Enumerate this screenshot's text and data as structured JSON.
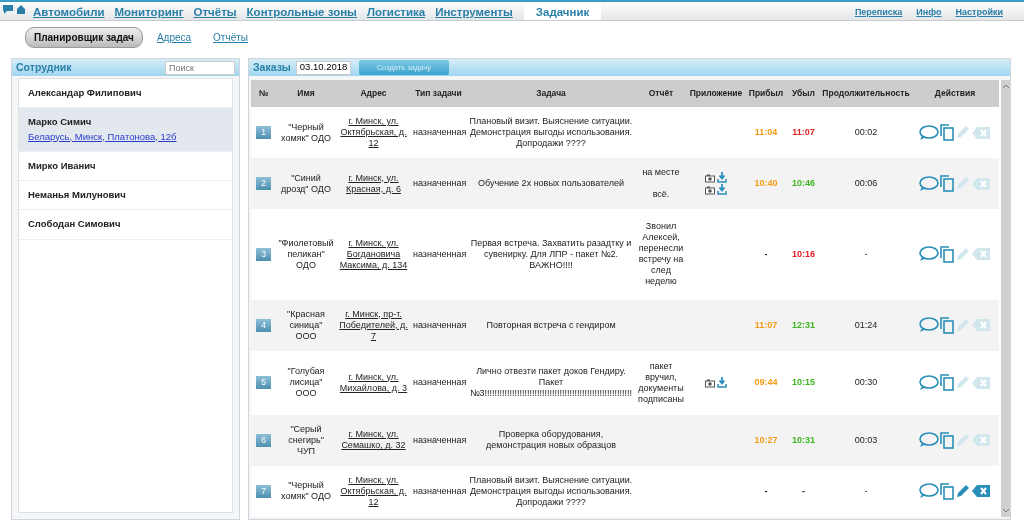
{
  "nav": {
    "items": [
      {
        "label": "Автомобили",
        "selected": false
      },
      {
        "label": "Мониторинг",
        "selected": false
      },
      {
        "label": "Отчёты",
        "selected": false
      },
      {
        "label": "Контрольные зоны",
        "selected": false
      },
      {
        "label": "Логистика",
        "selected": false
      },
      {
        "label": "Инструменты",
        "selected": false
      },
      {
        "label": "Задачник",
        "selected": true
      }
    ],
    "links": [
      "Переписка",
      "Инфо",
      "Настройки"
    ]
  },
  "subnav": [
    {
      "label": "Планировщик задач",
      "selected": true
    },
    {
      "label": "Адреса",
      "selected": false
    },
    {
      "label": "Отчёты",
      "selected": false
    }
  ],
  "employees": {
    "title": "Сотрудник",
    "search": {
      "placeholder": "Поиск"
    },
    "items": [
      {
        "name": "Александар Филипович",
        "selected": false
      },
      {
        "name": "Марко Симич",
        "address": "Беларусь, Минск, Платонова, 12б",
        "selected": true
      },
      {
        "name": "Мирко Иванич",
        "selected": false
      },
      {
        "name": "Неманья Милунович",
        "selected": false
      },
      {
        "name": "Слободан Симович",
        "selected": false
      }
    ]
  },
  "orders": {
    "title": "Заказы",
    "date": "03.10.2018",
    "create_button": "Создать задачу",
    "columns": [
      "№",
      "Имя",
      "Адрес",
      "Тип задачи",
      "Задача",
      "Отчёт",
      "Приложение",
      "Прибыл",
      "Убыл",
      "Продолжительность",
      "Действия"
    ],
    "rows": [
      {
        "number": "1",
        "name": "\"Черный хомяк\" ОДО",
        "address": "г. Минск, ул. Октябрьская, д. 12",
        "type": "назначенная",
        "task": "Плановый визит. Выяснение ситуации. Демонстрация выгоды использования. Допродажи ????",
        "report": [],
        "attachments": [],
        "arrived": {
          "text": "11:04",
          "color": "#f39c12"
        },
        "left": {
          "text": "11:07",
          "color": "#e02424"
        },
        "duration": "00:02",
        "editable": false
      },
      {
        "number": "2",
        "name": "\"Синий дрозд\" ОДО",
        "address": "г. Минск, ул. Красная, д. 6",
        "type": "назначенная",
        "task": "Обучение 2х новых пользователей",
        "report": [
          "на месте",
          "всё."
        ],
        "attachments": [
          {
            "kind": "photo"
          },
          {
            "kind": "photo"
          }
        ],
        "arrived": {
          "text": "10:40",
          "color": "#f39c12"
        },
        "left": {
          "text": "10:46",
          "color": "#3cb521"
        },
        "duration": "00:06",
        "editable": false
      },
      {
        "number": "3",
        "name": "\"Фиолетовый пеликан\" ОДО",
        "address": "г. Минск, ул. Богдановича Максима, д. 134",
        "type": "назначенная",
        "task": "Первая встреча. Захватить разадтку и сувенирку. Для ЛПР - пакет №2. ВАЖНО!!!!",
        "report": [
          "Звонил Алексей, перенесли встречу на след неделю"
        ],
        "attachments": [],
        "arrived": {
          "text": "-"
        },
        "left": {
          "text": "10:16",
          "color": "#e02424"
        },
        "duration": "-",
        "editable": false
      },
      {
        "number": "4",
        "name": "\"Красная синица\" ООО",
        "address": "г. Минск, пр-т. Победителей, д. 7",
        "type": "назначенная",
        "task": "Повторная встреча с гендиром",
        "report": [],
        "attachments": [],
        "arrived": {
          "text": "11:07",
          "color": "#f39c12"
        },
        "left": {
          "text": "12:31",
          "color": "#3cb521"
        },
        "duration": "01:24",
        "editable": false
      },
      {
        "number": "5",
        "name": "\"Голубая лисица\" ООО",
        "address": "г. Минск, ул. Михайлова, д. 3",
        "type": "назначенная",
        "task": "Лично отвезти пакет доков Гендиру. Пакет №3!!!!!!!!!!!!!!!!!!!!!!!!!!!!!!!!!!!!!!!!!!!!!!!!!!!!!!!!!!!",
        "report": [
          "пакет вручил, документы подписаны"
        ],
        "attachments": [
          {
            "kind": "photo"
          }
        ],
        "arrived": {
          "text": "09:44",
          "color": "#f39c12"
        },
        "left": {
          "text": "10:15",
          "color": "#3cb521"
        },
        "duration": "00:30",
        "editable": false
      },
      {
        "number": "6",
        "name": "\"Серый снегирь\" ЧУП",
        "address": "г. Минск, ул. Семашко, д. 32",
        "type": "назначенная",
        "task": "Проверка оборудования, демонстрация новых образцов",
        "report": [],
        "attachments": [],
        "arrived": {
          "text": "10:27",
          "color": "#f39c12"
        },
        "left": {
          "text": "10:31",
          "color": "#3cb521"
        },
        "duration": "00:03",
        "editable": false
      },
      {
        "number": "7",
        "name": "\"Черный хомяк\" ОДО",
        "address": "г. Минск, ул. Октябрьская, д. 12",
        "type": "назначенная",
        "task": "Плановый визит. Выяснение ситуации. Демонстрация выгоды использования. Допродажи ????",
        "report": [],
        "attachments": [],
        "arrived": {
          "text": "-"
        },
        "left": {
          "text": "-"
        },
        "duration": "-",
        "editable": true
      }
    ]
  }
}
